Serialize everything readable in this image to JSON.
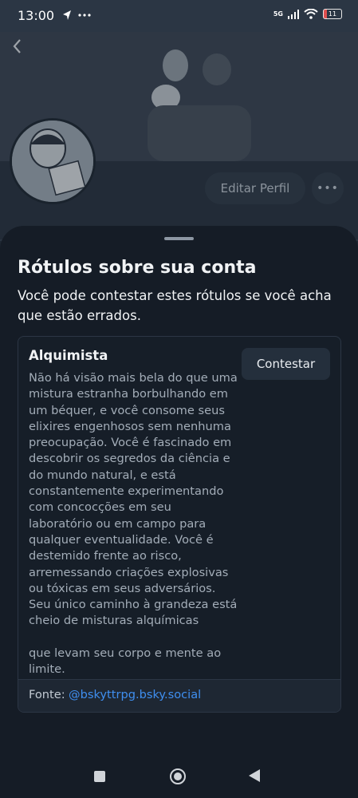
{
  "status_bar": {
    "time": "13:00",
    "network": "5G",
    "battery": "11",
    "icons": [
      "location-icon",
      "more-dots-icon",
      "signal-icon",
      "wifi-icon",
      "battery-icon"
    ]
  },
  "profile": {
    "edit_profile_label": "Editar Perfil",
    "more_label": "•••"
  },
  "sheet": {
    "title": "Rótulos sobre sua conta",
    "subtitle": "Você pode contestar estes rótulos se você acha que estão errados."
  },
  "label": {
    "name": "Alquimista",
    "description": "Não há visão mais bela do que uma mistura estranha borbulhando em um béquer, e você consome seus elixires engenhosos sem nenhuma preocupação. Você é fascinado em descobrir os segredos da ciência e do mundo natural, e está constantemente experimentando com concocções em seu laboratório ou em campo para qualquer eventualidade. Você é destemido frente ao risco, arremessando criações explosivas ou tóxicas em seus adversários. Seu único caminho à grandeza está cheio de misturas alquímicas\n\nque levam seu corpo e mente ao limite.",
    "appeal_label": "Contestar",
    "source_prefix": "Fonte:",
    "source_handle": "@bskyttrpg.bsky.social"
  },
  "colors": {
    "link": "#3f8ff0",
    "sheet_bg": "#151c26",
    "card_bg": "#161e28"
  }
}
